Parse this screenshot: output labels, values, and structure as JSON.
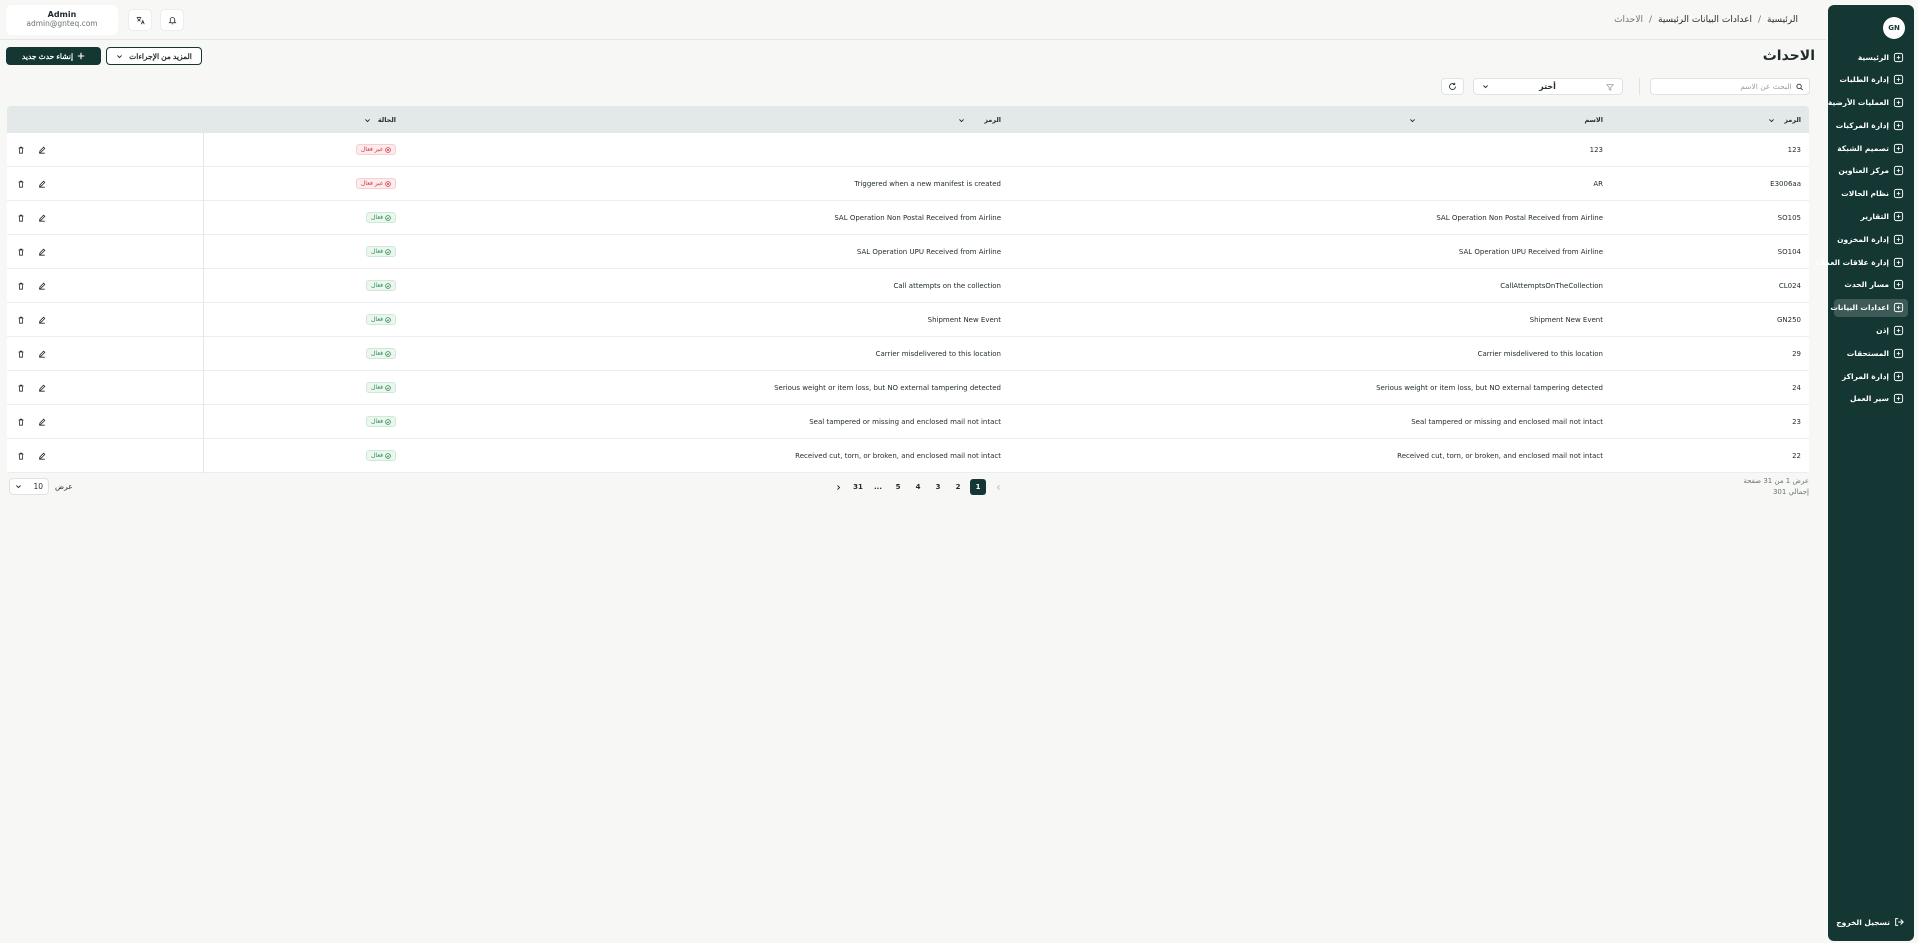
{
  "sidebar": {
    "logo": "GN",
    "items": [
      {
        "label": "الرئيسية",
        "icon": "dashboard-icon",
        "active": false
      },
      {
        "label": "إدارة الطلبات",
        "icon": "orders-icon",
        "active": false
      },
      {
        "label": "العمليات الأرضية",
        "icon": "ground-ops-icon",
        "active": false
      },
      {
        "label": "إدارة المركبات",
        "icon": "truck-icon",
        "active": false
      },
      {
        "label": "تصميم الشبكة",
        "icon": "network-icon",
        "active": false
      },
      {
        "label": "مركز العناوين",
        "icon": "location-icon",
        "active": false
      },
      {
        "label": "نظام الحالات",
        "icon": "status-grid-icon",
        "active": false
      },
      {
        "label": "التقارير",
        "icon": "report-icon",
        "active": false
      },
      {
        "label": "إدارة المخزون",
        "icon": "inventory-icon",
        "active": false
      },
      {
        "label": "إدارة علاقات العملاء",
        "icon": "crm-icon",
        "active": false
      },
      {
        "label": "مسار الحدث",
        "icon": "route-icon",
        "active": false
      },
      {
        "label": "اعدادات البيانات",
        "icon": "database-icon",
        "active": true
      },
      {
        "label": "إذن",
        "icon": "users-icon",
        "active": false
      },
      {
        "label": "المستحقات",
        "icon": "percent-icon",
        "active": false
      },
      {
        "label": "إدارة المراكز",
        "icon": "center-icon",
        "active": false
      },
      {
        "label": "سير العمل",
        "icon": "workflow-icon",
        "active": false
      }
    ],
    "logout": "تسجيل الخروج"
  },
  "breadcrumb": [
    "الرئيسية",
    "اعدادات البيانات الرئيسية",
    "الاحداث"
  ],
  "user": {
    "name": "Admin",
    "email": "admin@gnteq.com"
  },
  "page": {
    "title": "الاحداث",
    "create_button": "إنشاء حدث جديد",
    "more_actions": "المزيد من الإجراءات"
  },
  "toolbar": {
    "search_placeholder": "البحث عن الاسم",
    "filter_label": "أختر"
  },
  "table": {
    "headers": {
      "code": "الرمز",
      "name": "الاسم",
      "symbol": "الرمز",
      "status": "الحالة"
    },
    "rows": [
      {
        "code": "123",
        "name": "123",
        "symbol": "",
        "status": "غير فعال",
        "active": false
      },
      {
        "code": "E3006aa",
        "name": "AR",
        "symbol": "Triggered when a new manifest is created",
        "status": "غير فعال",
        "active": false
      },
      {
        "code": "SO105",
        "name": "SAL Operation Non Postal Received from Airline",
        "symbol": "SAL Operation Non Postal Received from Airline",
        "status": "فعال",
        "active": true
      },
      {
        "code": "SO104",
        "name": "SAL Operation UPU Received from Airline",
        "symbol": "SAL Operation UPU Received from Airline",
        "status": "فعال",
        "active": true
      },
      {
        "code": "CL024",
        "name": "CallAttemptsOnTheCollection",
        "symbol": "Call attempts on the collection",
        "status": "فعال",
        "active": true
      },
      {
        "code": "GN250",
        "name": "Shipment New Event",
        "symbol": "Shipment New Event",
        "status": "فعال",
        "active": true
      },
      {
        "code": "29",
        "name": "Carrier misdelivered to this location",
        "symbol": "Carrier misdelivered to this location",
        "status": "فعال",
        "active": true
      },
      {
        "code": "24",
        "name": "Serious weight or item loss, but NO external tampering detected",
        "symbol": "Serious weight or item loss, but NO external tampering detected",
        "status": "فعال",
        "active": true
      },
      {
        "code": "23",
        "name": "Seal tampered or missing and enclosed mail not intact",
        "symbol": "Seal tampered or missing and enclosed mail not intact",
        "status": "فعال",
        "active": true
      },
      {
        "code": "22",
        "name": "Received cut, torn, or broken, and enclosed mail not intact",
        "symbol": "Received cut, torn, or broken, and enclosed mail not intact",
        "status": "فعال",
        "active": true
      }
    ]
  },
  "footer": {
    "page_info": "عرض 1 من 31 صفحة",
    "total": "إجمالي 301",
    "pages": [
      "1",
      "2",
      "3",
      "4",
      "5",
      "...",
      "31"
    ],
    "current_page": "1",
    "page_size_label": "عرض",
    "page_size": "10"
  },
  "colors": {
    "sidebar": "#143734",
    "active_badge": "#2f8a52",
    "inactive_badge": "#d23640",
    "header_row": "#e3e9e8"
  }
}
